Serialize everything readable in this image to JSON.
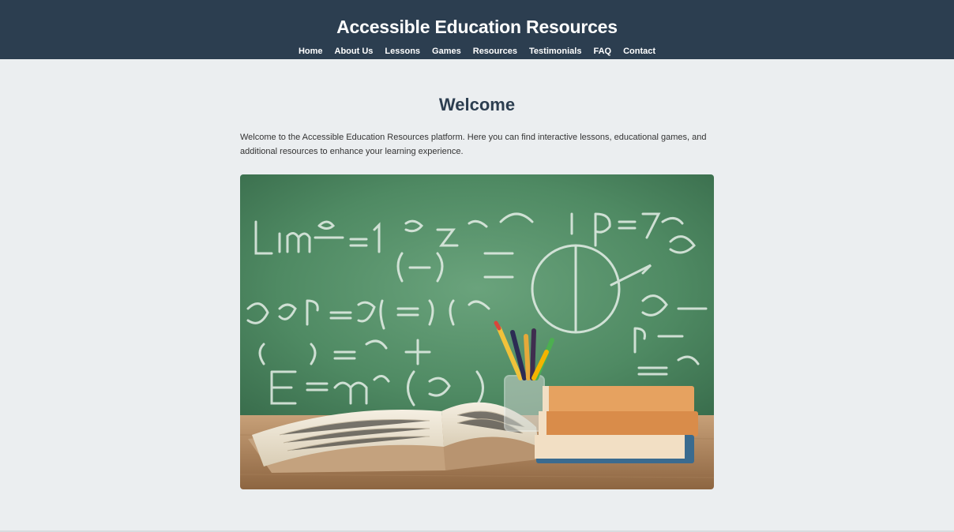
{
  "header": {
    "title": "Accessible Education Resources",
    "nav": [
      {
        "label": "Home"
      },
      {
        "label": "About Us"
      },
      {
        "label": "Lessons"
      },
      {
        "label": "Games"
      },
      {
        "label": "Resources"
      },
      {
        "label": "Testimonials"
      },
      {
        "label": "FAQ"
      },
      {
        "label": "Contact"
      }
    ]
  },
  "main": {
    "heading": "Welcome",
    "intro": "Welcome to the Accessible Education Resources platform. Here you can find interactive lessons, educational games, and additional resources to enhance your learning experience.",
    "hero_image": {
      "icon": "chalkboard-books-image"
    }
  },
  "colors": {
    "header_bg": "#2c3e50",
    "page_bg": "#ebeef0",
    "heading": "#2c3e50",
    "chalkboard": "#4f8a63"
  }
}
